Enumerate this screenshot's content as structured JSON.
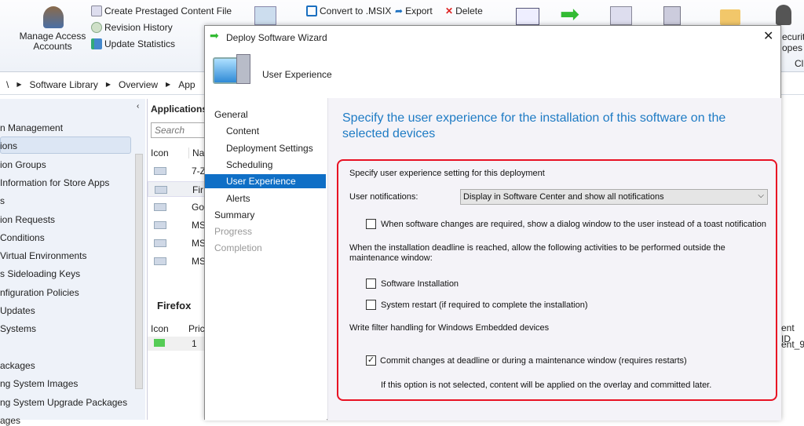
{
  "ribbon": {
    "manage_access": "Manage Access Accounts",
    "create_prestaged": "Create Prestaged Content File",
    "revision_history": "Revision History",
    "update_statistics": "Update Statistics",
    "convert_msix": "Convert to .MSIX",
    "export": "Export",
    "delete": "Delete",
    "security_scopes": "ecurity\nopes",
    "cl": "Cl"
  },
  "breadcrumb": [
    "\\",
    "Software Library",
    "Overview",
    "App"
  ],
  "nav": {
    "items": [
      "n Management",
      "ions",
      "ion Groups",
      "Information for Store Apps",
      "s",
      "ion Requests",
      "Conditions",
      "Virtual Environments",
      "s Sideloading Keys",
      "nfiguration Policies",
      "Updates",
      " Systems",
      "",
      "ackages",
      "ng System Images",
      "ng System Upgrade Packages",
      "ages"
    ]
  },
  "apps": {
    "title": "Applications",
    "search_placeholder": "Search",
    "col_icon": "Icon",
    "col_name": "Nar",
    "rows": [
      "7-Z",
      "Fir",
      "Go",
      "MS",
      "MS",
      "MS"
    ],
    "detail_title": "Firefox",
    "detail_col_icon": "Icon",
    "detail_col_prio": "Pric",
    "detail_row_prio": "1",
    "right_col": "ent ID",
    "right_val": "ent_9"
  },
  "dialog": {
    "title": "Deploy Software Wizard",
    "header": "User Experience",
    "steps": [
      "General",
      "Content",
      "Deployment Settings",
      "Scheduling",
      "User Experience",
      "Alerts",
      "Summary",
      "Progress",
      "Completion"
    ],
    "active_step": 4,
    "heading": "Specify the user experience for the installation of this software on the selected devices",
    "group_label": "Specify user experience setting for this deployment",
    "notifications_label": "User notifications:",
    "notifications_value": "Display in Software Center and show all notifications",
    "dialog_cb": {
      "label": "When software changes are required, show a dialog window to the user instead of a toast notification",
      "checked": false
    },
    "deadline_text": "When the installation deadline is reached, allow the following activities to be performed outside the maintenance window:",
    "software_install": {
      "label": "Software Installation",
      "checked": false
    },
    "system_restart": {
      "label": "System restart  (if required to complete the installation)",
      "checked": false
    },
    "write_filter_label": "Write filter handling for Windows Embedded devices",
    "commit": {
      "label": "Commit changes at deadline or during a maintenance window (requires restarts)",
      "checked": true
    },
    "commit_note": "If this option is not selected, content will be applied on the overlay and committed later."
  },
  "colors": {
    "heading": "#1e7bc4",
    "active_step": "#0f6fc6",
    "highlight": "#e81123"
  }
}
